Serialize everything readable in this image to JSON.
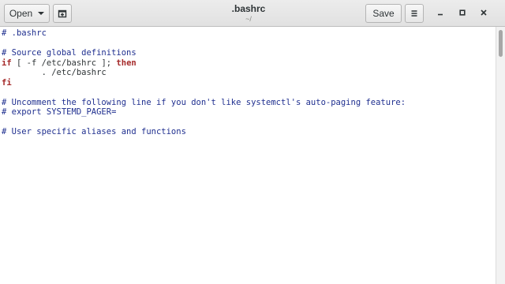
{
  "header": {
    "open_label": "Open",
    "save_label": "Save",
    "title": ".bashrc",
    "subtitle": "~/"
  },
  "icons": {
    "open_dropdown": "chevron-down-icon",
    "new_tab": "new-document-icon",
    "menu": "hamburger-menu-icon",
    "minimize": "minimize-icon",
    "maximize": "maximize-icon",
    "close": "close-icon"
  },
  "editor": {
    "lines": [
      {
        "parts": [
          {
            "text": "# .bashrc",
            "style": "comment"
          }
        ]
      },
      {
        "parts": []
      },
      {
        "parts": [
          {
            "text": "# Source global definitions",
            "style": "comment"
          }
        ]
      },
      {
        "parts": [
          {
            "text": "if",
            "style": "kw"
          },
          {
            "text": " [ -f /etc/bashrc ]; ",
            "style": "plain"
          },
          {
            "text": "then",
            "style": "kw"
          }
        ]
      },
      {
        "parts": [
          {
            "text": "        . /etc/bashrc",
            "style": "plain"
          }
        ]
      },
      {
        "parts": [
          {
            "text": "fi",
            "style": "kw"
          }
        ]
      },
      {
        "parts": []
      },
      {
        "parts": [
          {
            "text": "# Uncomment the following line if you don't like systemctl's auto-paging feature:",
            "style": "comment"
          }
        ]
      },
      {
        "parts": [
          {
            "text": "# export SYSTEMD_PAGER=",
            "style": "comment"
          }
        ]
      },
      {
        "parts": []
      },
      {
        "parts": [
          {
            "text": "# User specific aliases and functions",
            "style": "comment"
          }
        ]
      }
    ]
  },
  "colors": {
    "comment": "#1f2f8f",
    "keyword": "#a52a2a",
    "text": "#2e3436"
  }
}
